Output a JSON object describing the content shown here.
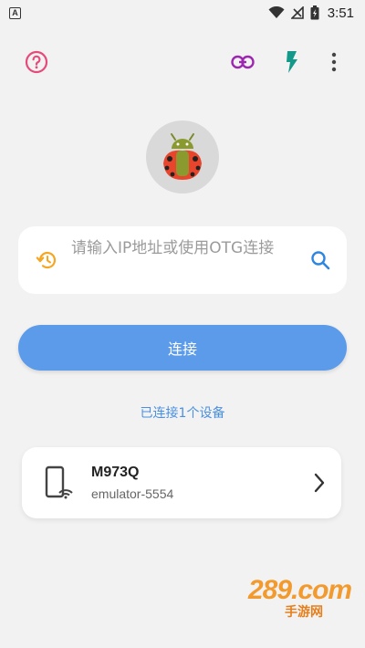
{
  "status_bar": {
    "app_icon_letter": "A",
    "time": "3:51",
    "icons": [
      "wifi-icon",
      "no-signal-icon",
      "battery-charging-icon"
    ]
  },
  "toolbar": {
    "icons": [
      "help-icon",
      "link-icon",
      "flash-icon",
      "more-vert-icon"
    ]
  },
  "colors": {
    "accent": "#5b9bea",
    "help": "#e64a7b",
    "link": "#9c27b0",
    "flash": "#12998a",
    "history": "#f5a623",
    "search": "#2e86de"
  },
  "ip_input": {
    "placeholder": "请输入IP地址或使用OTG连接"
  },
  "connect_button": {
    "label": "连接"
  },
  "connected_status": "已连接1个设备",
  "device": {
    "name": "M973Q",
    "serial": "emulator-5554",
    "icon": "phone-wifi-icon"
  },
  "watermark": {
    "brand": "289.com",
    "sub": "手游网"
  }
}
